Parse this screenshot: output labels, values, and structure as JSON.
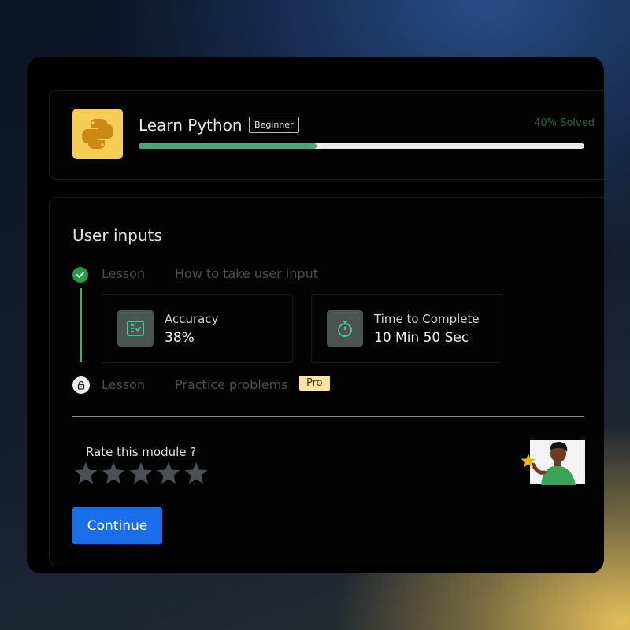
{
  "course": {
    "title": "Learn Python",
    "level_badge": "Beginner",
    "solved_label": "40% Solved",
    "progress_fraction": 0.4,
    "logo_icon": "python-logo",
    "logo_bg": "#f5cd56"
  },
  "module": {
    "title": "User inputs",
    "lessons": [
      {
        "label": "Lesson",
        "name": "How to take user input",
        "status": "completed",
        "icon": "check-circle-icon",
        "stats": [
          {
            "label": "Accuracy",
            "value": "38%",
            "icon": "checklist-icon"
          },
          {
            "label": "Time to Complete",
            "value": "10 Min 50 Sec",
            "icon": "stopwatch-icon"
          }
        ]
      },
      {
        "label": "Lesson",
        "name": "Practice problems",
        "status": "locked",
        "icon": "lock-icon",
        "badge": "Pro"
      }
    ]
  },
  "rating": {
    "prompt": "Rate this module ?",
    "max_stars": 5,
    "value": 0,
    "illustration": "person-holding-star"
  },
  "actions": {
    "continue_label": "Continue"
  },
  "colors": {
    "accent": "#1a6fe8",
    "progress_fill": "#4ea57a",
    "success": "#1e9f47",
    "pro_badge_bg": "#fbe3a3",
    "solved_text": "#1c6b3f"
  }
}
